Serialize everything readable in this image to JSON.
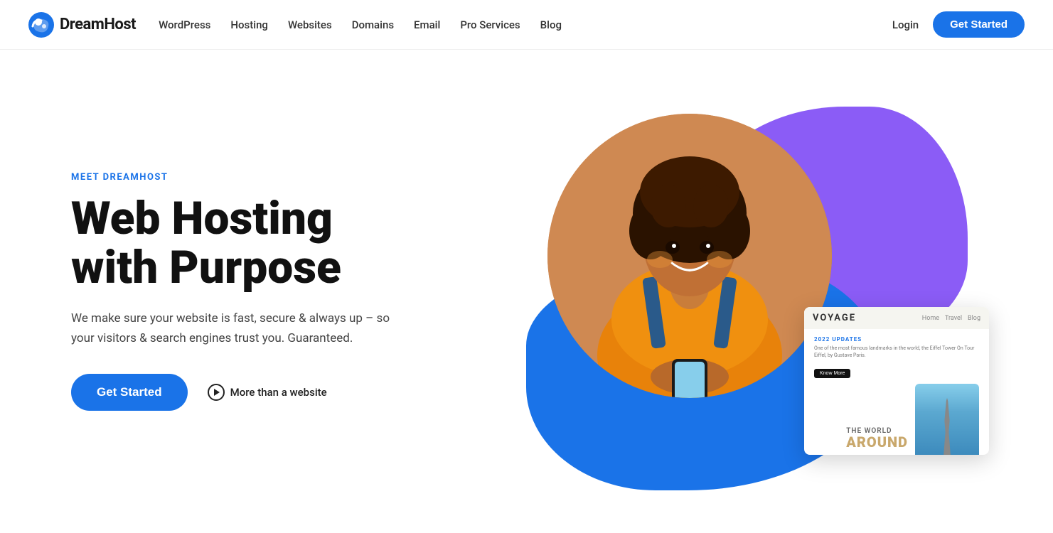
{
  "brand": {
    "name": "DreamHost",
    "logo_alt": "DreamHost logo"
  },
  "nav": {
    "links": [
      {
        "label": "WordPress",
        "id": "wordpress"
      },
      {
        "label": "Hosting",
        "id": "hosting"
      },
      {
        "label": "Websites",
        "id": "websites"
      },
      {
        "label": "Domains",
        "id": "domains"
      },
      {
        "label": "Email",
        "id": "email"
      },
      {
        "label": "Pro Services",
        "id": "pro-services"
      },
      {
        "label": "Blog",
        "id": "blog"
      }
    ],
    "login_label": "Login",
    "cta_label": "Get Started"
  },
  "hero": {
    "eyebrow": "MEET DREAMHOST",
    "heading_line1": "Web Hosting",
    "heading_line2": "with Purpose",
    "subtext": "We make sure your website is fast, secure & always up – so your visitors & search engines trust you. Guaranteed.",
    "cta_label": "Get Started",
    "more_label": "More than a website"
  },
  "website_card": {
    "brand": "VOYAGE",
    "nav_items": [
      "Home",
      "Travel",
      "Blog"
    ],
    "tag": "2022 UPDATES",
    "title": "One of the most famous landmarks in the world, the Eiffel Tower On Tour Eiffel, by Gustave Paris.",
    "btn_label": "Know More",
    "world_text": "THE WORLD",
    "around_text": "AROUND"
  }
}
